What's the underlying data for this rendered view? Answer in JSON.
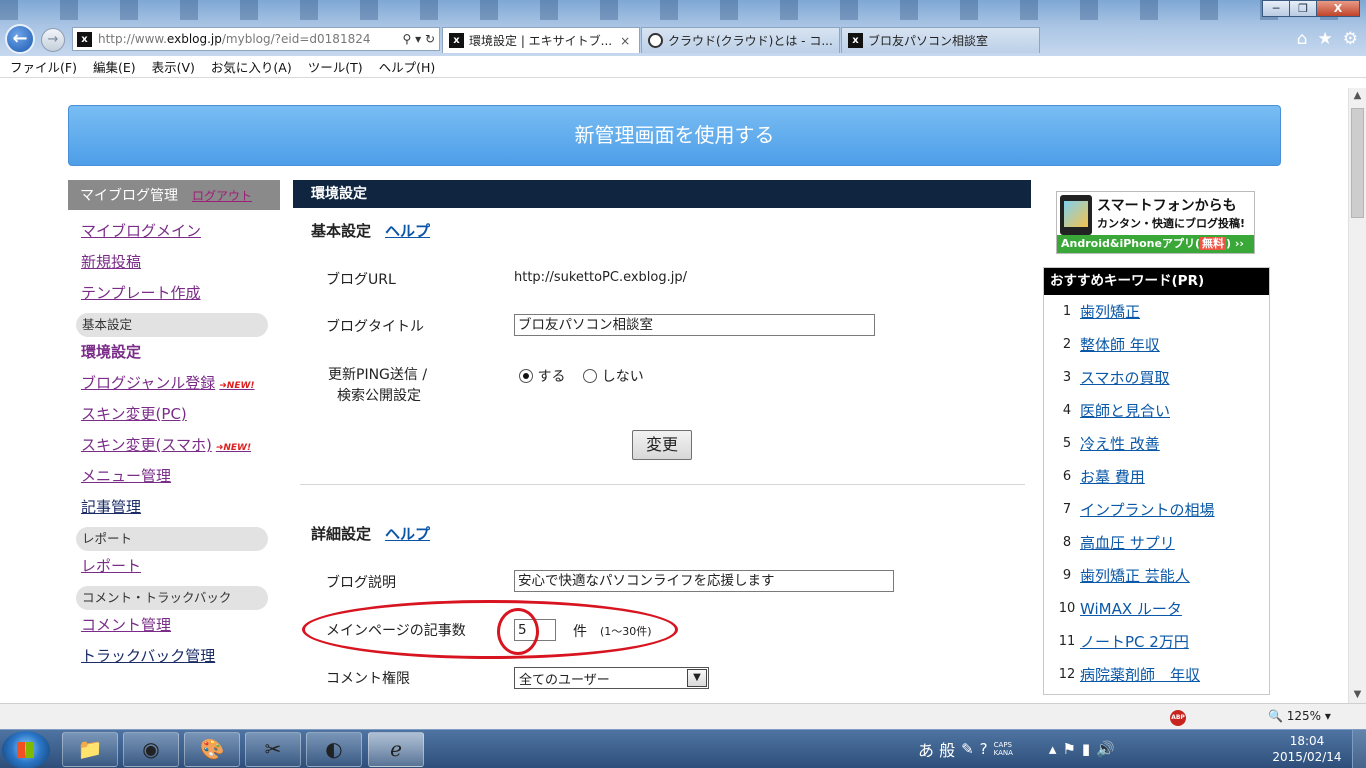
{
  "browser": {
    "window_buttons": [
      "─",
      "❐",
      "X"
    ],
    "address": {
      "prefix": "http://www.",
      "domain": "exblog.jp",
      "path": "/myblog/?eid=d0181824",
      "controls": "⚲ ▾ ↻"
    },
    "favicon_letter": "x",
    "tabs": [
      {
        "label": "環境設定 | エキサイトブ...",
        "close": "×"
      },
      {
        "label": "クラウド(クラウド)とは - コ..."
      },
      {
        "label": "ブロ友パソコン相談室"
      }
    ],
    "menu": [
      "ファイル(F)",
      "編集(E)",
      "表示(V)",
      "お気に入り(A)",
      "ツール(T)",
      "ヘルプ(H)"
    ]
  },
  "banner": {
    "label": "新管理画面を使用する"
  },
  "sidebar": {
    "header": "マイブログ管理",
    "logout": "ログアウト",
    "top_links": [
      "マイブログメイン",
      "新規投稿",
      "テンプレート作成"
    ],
    "section_basic": "基本設定",
    "basic_links": [
      "環境設定",
      "ブログジャンル登録",
      "スキン変更(PC)",
      "スキン変更(スマホ)",
      "メニュー管理",
      "記事管理"
    ],
    "new_badge": "➜NEW!",
    "section_report": "レポート",
    "report_link": "レポート",
    "section_comment": "コメント・トラックバック",
    "comment_links": [
      "コメント管理",
      "トラックバック管理"
    ]
  },
  "main": {
    "title": "環境設定",
    "basic": {
      "heading": "基本設定",
      "help": "ヘルプ",
      "blog_url_label": "ブログURL",
      "blog_url_value": "http://sukettoPC.exblog.jp/",
      "blog_title_label": "ブログタイトル",
      "blog_title_value": "ブロ友パソコン相談室",
      "ping_label_1": "更新PING送信 /",
      "ping_label_2": "検索公開設定",
      "radio_yes": "する",
      "radio_no": "しない",
      "radio_selected": "する",
      "submit": "変更"
    },
    "detail": {
      "heading": "詳細設定",
      "help": "ヘルプ",
      "desc_label": "ブログ説明",
      "desc_value": "安心で快適なパソコンライフを応援します",
      "count_label": "メインページの記事数",
      "count_value": "5",
      "count_unit": "件",
      "count_range": "(1〜30件)",
      "comment_label": "コメント権限",
      "comment_value": "全てのユーザー"
    }
  },
  "right": {
    "ad": {
      "line1": "スマートフォンからも",
      "line2": "カンタン・快適にブログ投稿!",
      "line3": "Android&iPhoneアプリ",
      "free": "無料",
      "arrows": "››"
    },
    "keywords_title": "おすすめキーワード(PR)",
    "keywords": [
      {
        "n": "1",
        "t": "歯列矯正"
      },
      {
        "n": "2",
        "t": "整体師 年収"
      },
      {
        "n": "3",
        "t": "スマホの買取"
      },
      {
        "n": "4",
        "t": "医師と見合い"
      },
      {
        "n": "5",
        "t": "冷え性 改善"
      },
      {
        "n": "6",
        "t": "お墓 費用"
      },
      {
        "n": "7",
        "t": "インプラントの相場"
      },
      {
        "n": "8",
        "t": "高血圧 サプリ"
      },
      {
        "n": "9",
        "t": "歯列矯正 芸能人"
      },
      {
        "n": "10",
        "t": "WiMAX ルータ"
      },
      {
        "n": "11",
        "t": "ノートPC 2万円"
      },
      {
        "n": "12",
        "t": "病院薬剤師　年収"
      }
    ]
  },
  "statusbar": {
    "abp": "ABP",
    "zoom": "125%"
  },
  "taskbar": {
    "ime": "あ 般",
    "caps": "CAPS",
    "kana": "KANA",
    "time": "18:04",
    "date": "2015/02/14"
  },
  "colors": {
    "banner": "#4d9ee8",
    "main_header": "#0f2540",
    "link_visited": "#7a2c88",
    "link": "#0b58a8",
    "annotation_red": "#d7141f"
  }
}
